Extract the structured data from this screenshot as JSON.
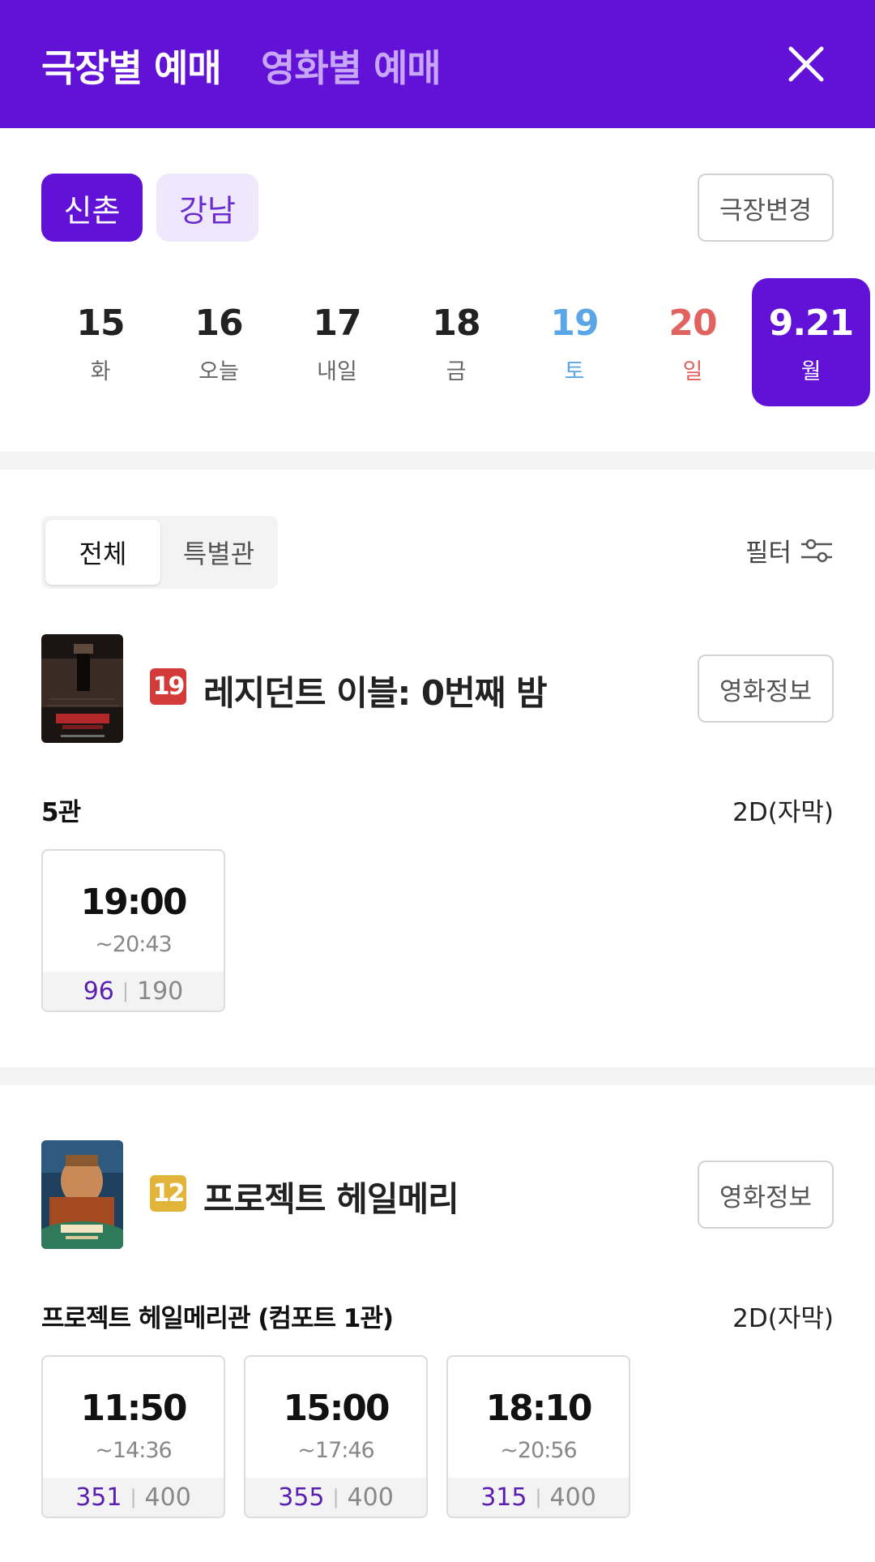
{
  "header": {
    "tab_theater": "극장별 예매",
    "tab_movie": "영화별 예매",
    "close_icon": "close-icon"
  },
  "theaters": {
    "chips": [
      "신촌",
      "강남"
    ],
    "selected": "신촌",
    "change_label": "극장변경"
  },
  "dates": [
    {
      "num": "15",
      "day": "화"
    },
    {
      "num": "16",
      "day": "오늘"
    },
    {
      "num": "17",
      "day": "내일"
    },
    {
      "num": "18",
      "day": "금"
    },
    {
      "num": "19",
      "day": "토"
    },
    {
      "num": "20",
      "day": "일"
    },
    {
      "num": "9.21",
      "day": "월"
    }
  ],
  "segment": {
    "all": "전체",
    "special": "특별관"
  },
  "filter": {
    "label": "필터",
    "icon": "filter-sliders-icon"
  },
  "movies": [
    {
      "rating": "19",
      "title": "레지던트 이블: 0번째 밤",
      "info_label": "영화정보",
      "hall": "5관",
      "format": "2D(자막)",
      "showtimes": [
        {
          "start": "19:00",
          "end": "~20:43",
          "available": "96",
          "total": "190"
        }
      ]
    },
    {
      "rating": "12",
      "title": "프로젝트 헤일메리",
      "info_label": "영화정보",
      "hall": "프로젝트 헤일메리관 (컴포트 1관)",
      "format": "2D(자막)",
      "showtimes": [
        {
          "start": "11:50",
          "end": "~14:36",
          "available": "351",
          "total": "400"
        },
        {
          "start": "15:00",
          "end": "~17:46",
          "available": "355",
          "total": "400"
        },
        {
          "start": "18:10",
          "end": "~20:56",
          "available": "315",
          "total": "400"
        }
      ]
    }
  ],
  "colors": {
    "primary": "#6212d6",
    "saturday": "#5aa6e6",
    "sunday": "#e16360",
    "rating19": "#d33b3b",
    "rating12": "#e2b53a"
  }
}
